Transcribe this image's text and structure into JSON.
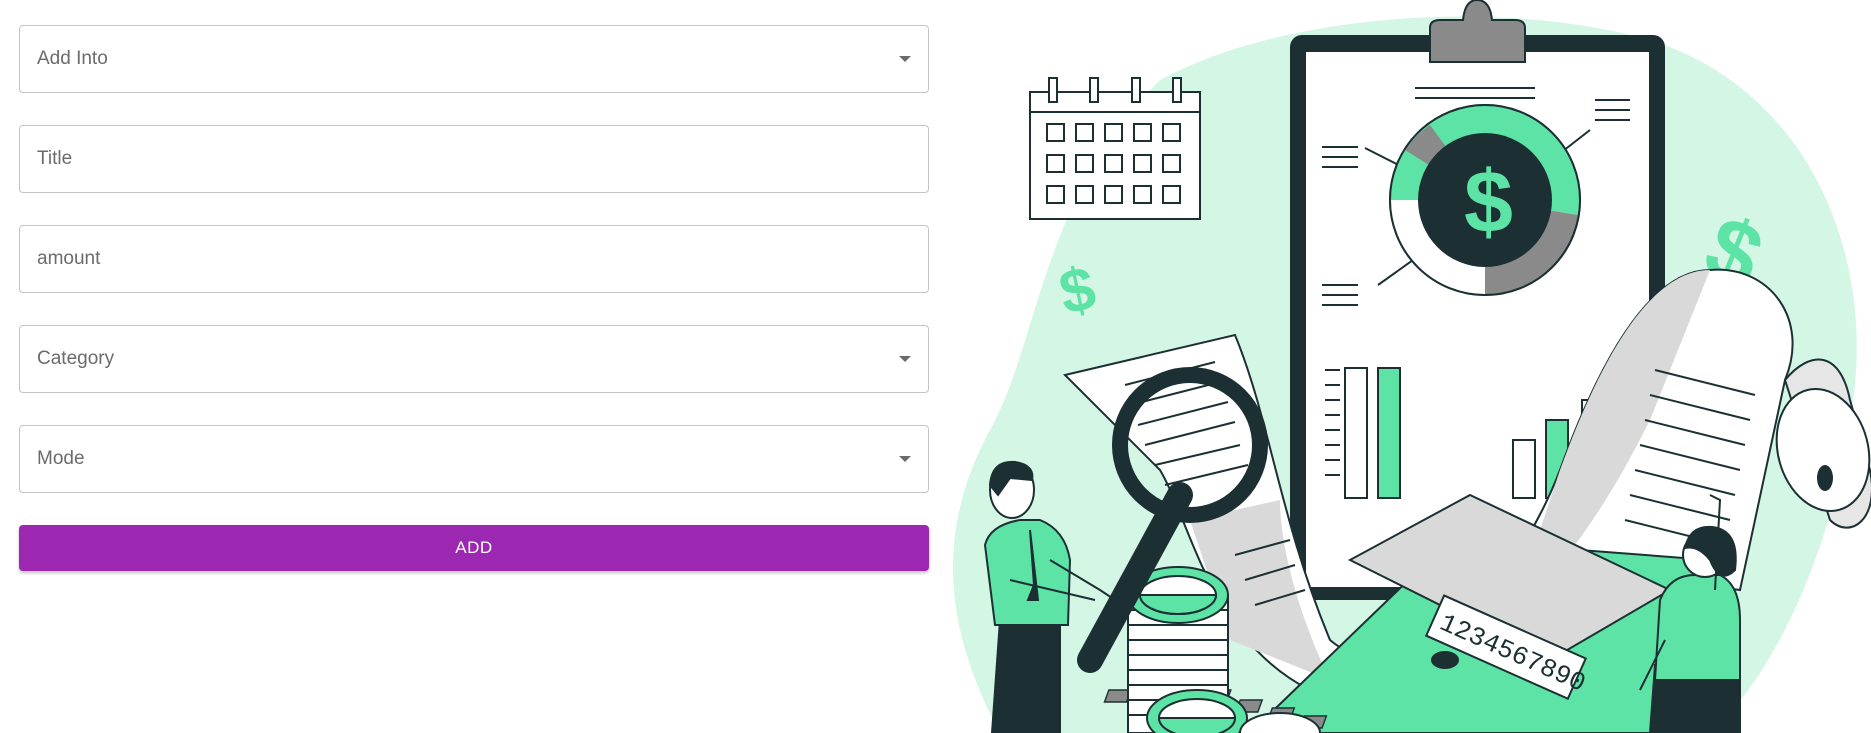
{
  "form": {
    "fields": [
      {
        "label": "Add Into",
        "type": "select"
      },
      {
        "label": "Title",
        "type": "text"
      },
      {
        "label": "amount",
        "type": "text"
      },
      {
        "label": "Category",
        "type": "select"
      },
      {
        "label": "Mode",
        "type": "select"
      }
    ],
    "add_label": "ADD"
  },
  "illustration": {
    "calculator_display": "1234567890",
    "accent_color": "#5de3a5",
    "dark_color": "#1c3034",
    "button_color": "#9c27b0"
  }
}
